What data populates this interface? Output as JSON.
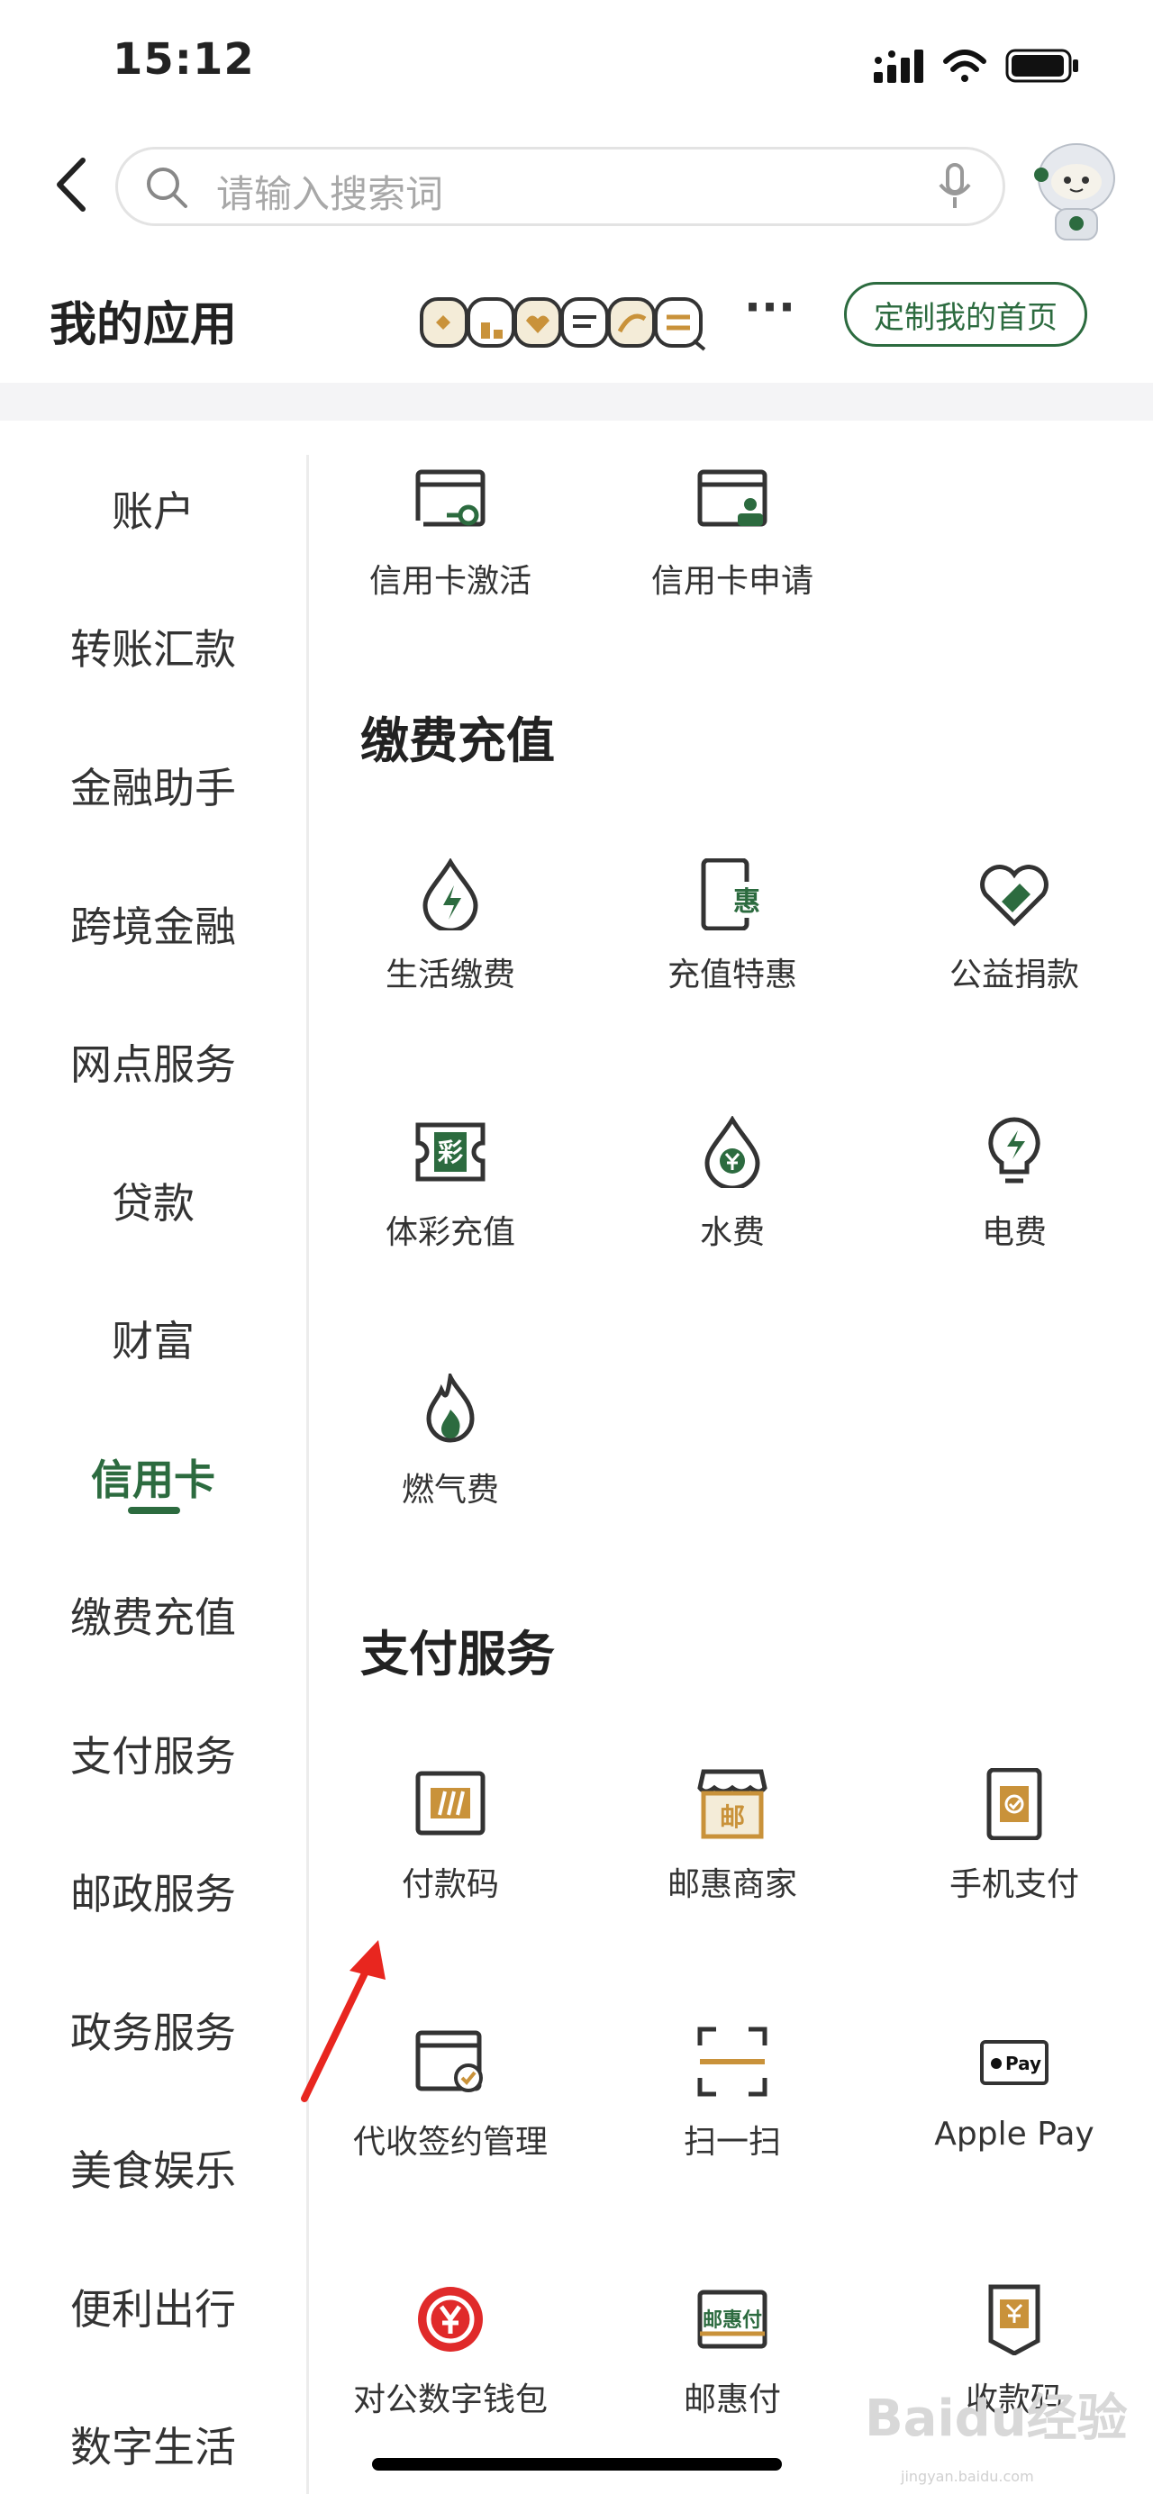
{
  "status": {
    "time": "15:12"
  },
  "search": {
    "placeholder": "请输入搜索词"
  },
  "header": {
    "title": "我的应用",
    "more": "···",
    "customize_label": "定制我的首页"
  },
  "sidebar": {
    "active_index": 7,
    "items": [
      "账户",
      "转账汇款",
      "金融助手",
      "跨境金融",
      "网点服务",
      "贷款",
      "财富",
      "信用卡",
      "缴费充值",
      "支付服务",
      "邮政服务",
      "政务服务",
      "美食娱乐",
      "便利出行",
      "数字生活"
    ]
  },
  "sections": [
    {
      "title": "",
      "apps": [
        {
          "label": "信用卡激活",
          "icon": "card-activate-icon"
        },
        {
          "label": "信用卡申请",
          "icon": "card-apply-icon"
        }
      ]
    },
    {
      "title": "缴费充值",
      "apps": [
        {
          "label": "生活缴费",
          "icon": "lightning-drop-icon"
        },
        {
          "label": "充值特惠",
          "icon": "phone-hui-icon"
        },
        {
          "label": "公益捐款",
          "icon": "heart-hands-icon"
        },
        {
          "label": "体彩充值",
          "icon": "lottery-ticket-icon"
        },
        {
          "label": "水费",
          "icon": "water-drop-icon"
        },
        {
          "label": "电费",
          "icon": "bulb-icon"
        },
        {
          "label": "燃气费",
          "icon": "flame-icon"
        }
      ]
    },
    {
      "title": "支付服务",
      "apps": [
        {
          "label": "付款码",
          "icon": "barcode-icon"
        },
        {
          "label": "邮惠商家",
          "icon": "shop-icon"
        },
        {
          "label": "手机支付",
          "icon": "mobile-pay-icon"
        },
        {
          "label": "代收签约管理",
          "icon": "contract-icon"
        },
        {
          "label": "扫一扫",
          "icon": "scan-icon"
        },
        {
          "label": "Apple Pay",
          "icon": "apple-pay-icon"
        },
        {
          "label": "对公数字钱包",
          "icon": "digital-yuan-icon"
        },
        {
          "label": "邮惠付",
          "icon": "youhuifu-icon"
        },
        {
          "label": "收款码",
          "icon": "receive-code-icon"
        }
      ]
    }
  ],
  "icon_text": {
    "hui": "惠",
    "cai": "彩",
    "you": "邮",
    "pay": "Pay",
    "yhf": "邮惠付"
  },
  "watermark": {
    "text": "Baidu经验",
    "sub": "jingyan.baidu.com"
  },
  "colors": {
    "brand_green": "#2c6b3f",
    "orange": "#c9923a",
    "red": "#e02a2a",
    "dark": "#333333"
  }
}
